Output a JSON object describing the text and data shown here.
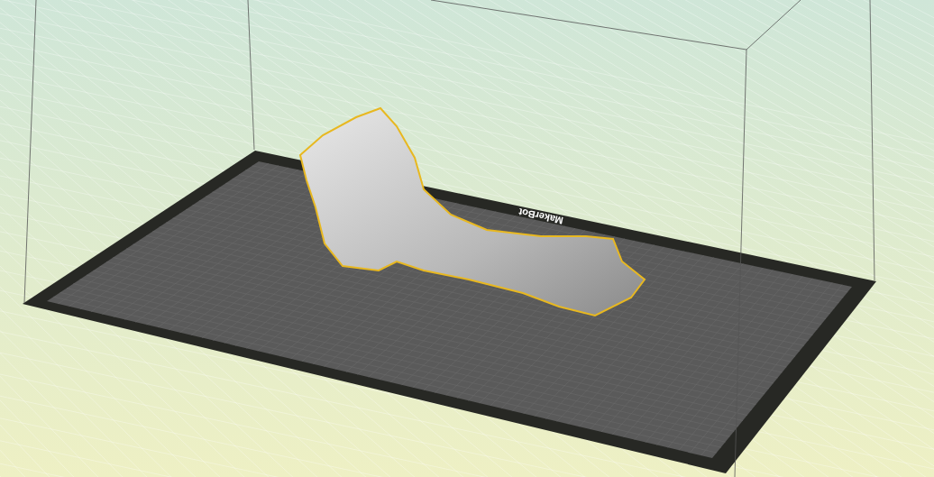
{
  "build_plate": {
    "label": "MakerBot"
  }
}
